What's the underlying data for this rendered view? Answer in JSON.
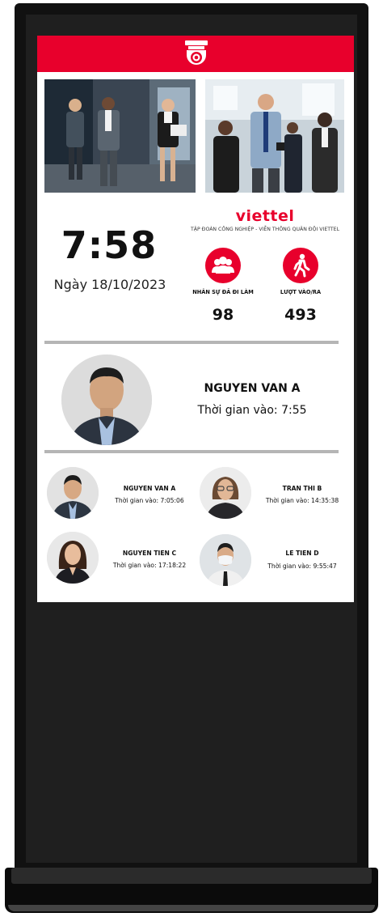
{
  "colors": {
    "accent": "#e8002c",
    "frame": "#111111",
    "divider": "#b5b5b5"
  },
  "header": {
    "icon": "security-camera-icon"
  },
  "clock": {
    "time": "7:58",
    "date": "Ngày 18/10/2023"
  },
  "brand": {
    "name": "viettel",
    "subtitle": "TẬP ĐOÀN CÔNG NGHIỆP - VIỄN THÔNG QUÂN ĐỘI VIETTEL"
  },
  "stats": {
    "staff": {
      "icon": "people-group-icon",
      "label": "NHÂN SỰ ĐÃ ĐI LÀM",
      "value": "98"
    },
    "visits": {
      "icon": "walking-person-icon",
      "label": "LƯỢT VÀO/RA",
      "value": "493"
    }
  },
  "current_person": {
    "name": "NGUYEN VAN A",
    "time": "Thời gian vào: 7:55"
  },
  "recent_people": [
    {
      "name": "NGUYEN VAN A",
      "time": "Thời gian vào: 7:05:06"
    },
    {
      "name": "TRAN THI B",
      "time": "Thời gian vào: 14:35:38"
    },
    {
      "name": "NGUYEN TIEN C",
      "time": "Thời gian vào: 17:18:22"
    },
    {
      "name": "LE TIEN D",
      "time": "Thời gian vào: 9:55:47"
    }
  ]
}
